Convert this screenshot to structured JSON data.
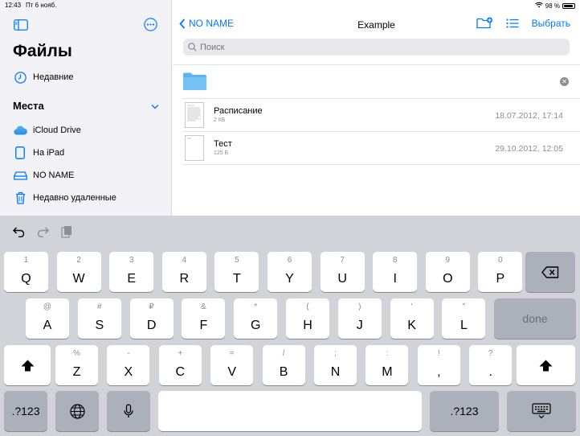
{
  "status": {
    "time": "12:43",
    "date": "Пт 6 нояб.",
    "battery": "98 %"
  },
  "sidebar": {
    "title": "Файлы",
    "recent": "Недавние",
    "places_header": "Места",
    "items": [
      {
        "label": "iCloud Drive",
        "icon": "icloud-icon"
      },
      {
        "label": "На iPad",
        "icon": "ipad-icon"
      },
      {
        "label": "NO NAME",
        "icon": "drive-icon"
      },
      {
        "label": "Недавно удаленные",
        "icon": "trash-icon"
      }
    ]
  },
  "nav": {
    "back_label": "NO NAME",
    "title": "Example",
    "select_label": "Выбрать"
  },
  "search": {
    "placeholder": "Поиск"
  },
  "new_folder": {
    "value": ""
  },
  "files": [
    {
      "name": "Расписание",
      "size": "2 КБ",
      "date": "18.07.2012, 17:14"
    },
    {
      "name": "Тест",
      "size": "125 Б",
      "date": "29.10.2012, 12:05"
    }
  ],
  "keyboard": {
    "row1": [
      {
        "main": "Q",
        "sub": "1"
      },
      {
        "main": "W",
        "sub": "2"
      },
      {
        "main": "E",
        "sub": "3"
      },
      {
        "main": "R",
        "sub": "4"
      },
      {
        "main": "T",
        "sub": "5"
      },
      {
        "main": "Y",
        "sub": "6"
      },
      {
        "main": "U",
        "sub": "7"
      },
      {
        "main": "I",
        "sub": "8"
      },
      {
        "main": "O",
        "sub": "9"
      },
      {
        "main": "P",
        "sub": "0"
      }
    ],
    "row2": [
      {
        "main": "A",
        "sub": "@"
      },
      {
        "main": "S",
        "sub": "#"
      },
      {
        "main": "D",
        "sub": "₽"
      },
      {
        "main": "F",
        "sub": "&"
      },
      {
        "main": "G",
        "sub": "*"
      },
      {
        "main": "H",
        "sub": "("
      },
      {
        "main": "J",
        "sub": ")"
      },
      {
        "main": "K",
        "sub": "'"
      },
      {
        "main": "L",
        "sub": "\""
      }
    ],
    "row3": [
      {
        "main": "Z",
        "sub": "%"
      },
      {
        "main": "X",
        "sub": "-"
      },
      {
        "main": "C",
        "sub": "+"
      },
      {
        "main": "V",
        "sub": "="
      },
      {
        "main": "B",
        "sub": "/"
      },
      {
        "main": "N",
        "sub": ";"
      },
      {
        "main": "M",
        "sub": ":"
      },
      {
        "main": ",",
        "sub": "!"
      },
      {
        "main": ".",
        "sub": "?"
      }
    ],
    "done_label": "done",
    "numbers_label": ".?123"
  },
  "colors": {
    "accent": "#007aff",
    "keyboard_bg": "#d1d3d9",
    "sidebar_bg": "#f2f2f7",
    "folder": "#5ab4f0"
  }
}
